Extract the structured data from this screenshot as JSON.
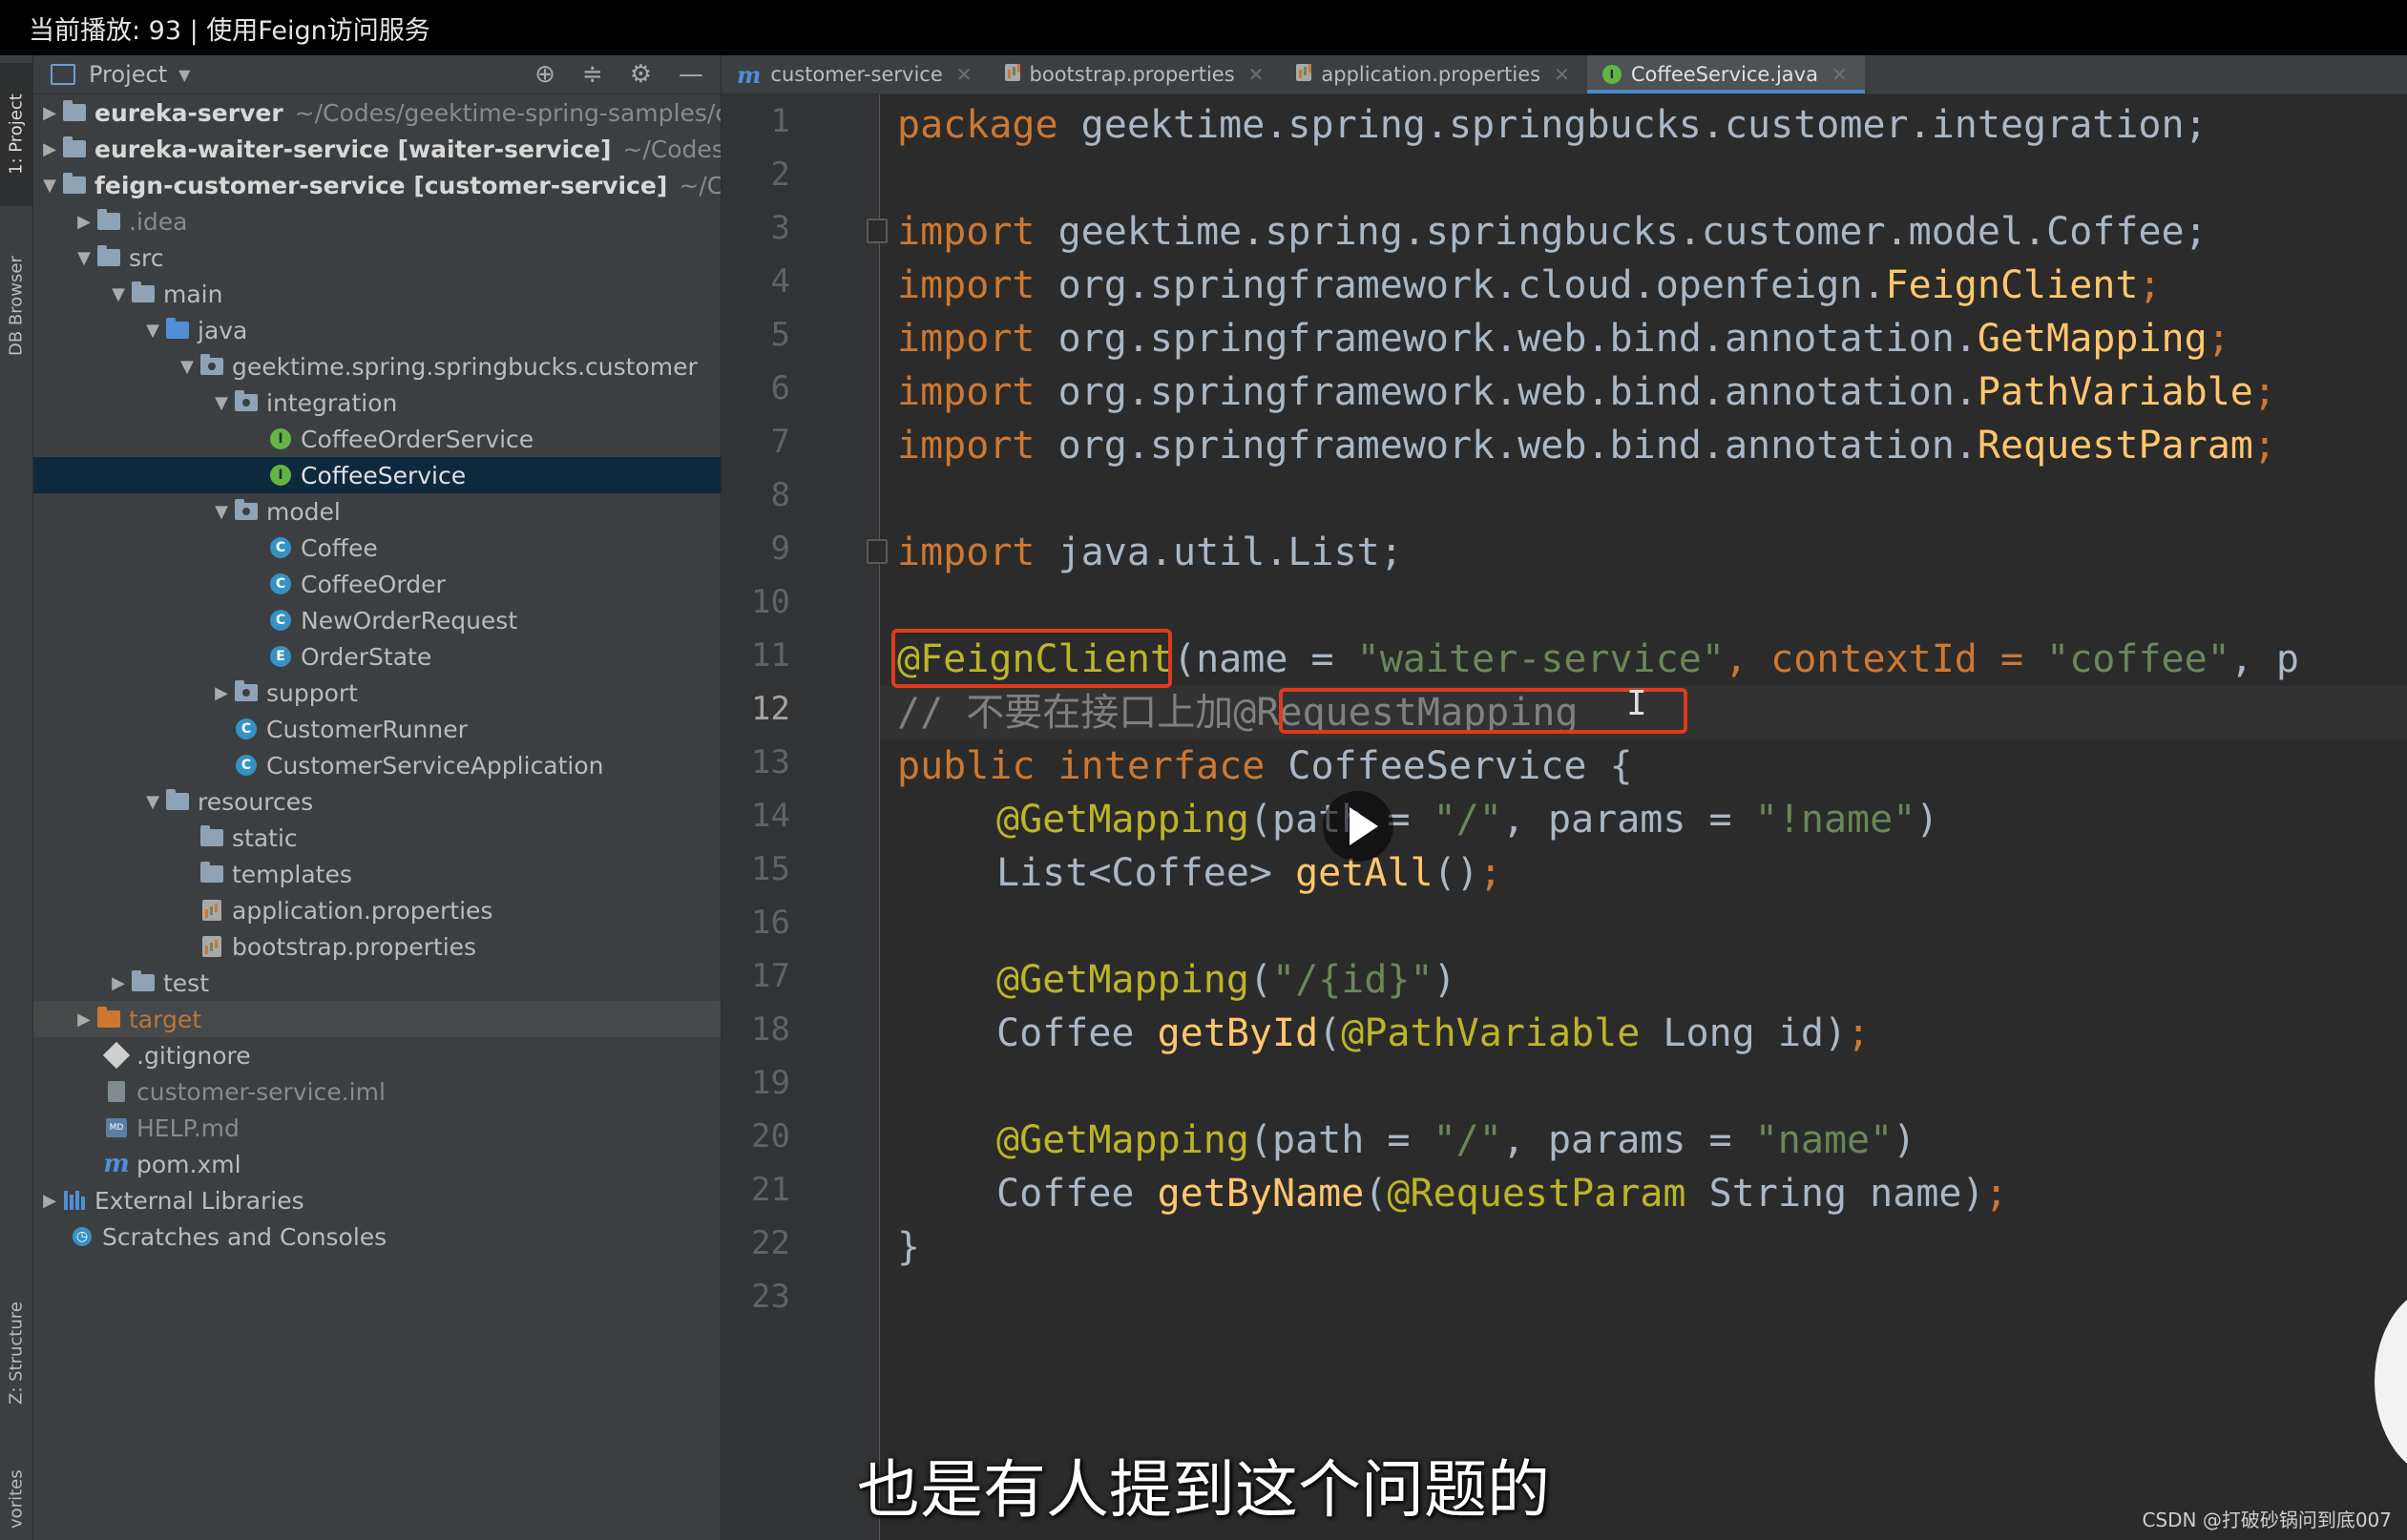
{
  "video_title": "当前播放: 93 | 使用Feign访问服务",
  "subtitle": "也是有人提到这个问题的",
  "watermark": "CSDN @打破砂锅问到底007",
  "side_tabs": {
    "project": "1: Project",
    "db": "DB Browser",
    "structure": "Z: Structure",
    "favorites": "vorites"
  },
  "project_panel": {
    "title": "Project",
    "tree": [
      {
        "name": "eureka-server",
        "extra": "~/Codes/geektime-spring-samples/c"
      },
      {
        "name": "eureka-waiter-service [waiter-service]",
        "extra": "~/Codes/ge"
      },
      {
        "name": "feign-customer-service [customer-service]",
        "extra": "~/Cod"
      },
      {
        "name": ".idea"
      },
      {
        "name": "src"
      },
      {
        "name": "main"
      },
      {
        "name": "java"
      },
      {
        "name": "geektime.spring.springbucks.customer"
      },
      {
        "name": "integration"
      },
      {
        "name": "CoffeeOrderService"
      },
      {
        "name": "CoffeeService"
      },
      {
        "name": "model"
      },
      {
        "name": "Coffee"
      },
      {
        "name": "CoffeeOrder"
      },
      {
        "name": "NewOrderRequest"
      },
      {
        "name": "OrderState"
      },
      {
        "name": "support"
      },
      {
        "name": "CustomerRunner"
      },
      {
        "name": "CustomerServiceApplication"
      },
      {
        "name": "resources"
      },
      {
        "name": "static"
      },
      {
        "name": "templates"
      },
      {
        "name": "application.properties"
      },
      {
        "name": "bootstrap.properties"
      },
      {
        "name": "test"
      },
      {
        "name": "target"
      },
      {
        "name": ".gitignore"
      },
      {
        "name": "customer-service.iml"
      },
      {
        "name": "HELP.md"
      },
      {
        "name": "pom.xml"
      },
      {
        "name": "External Libraries"
      },
      {
        "name": "Scratches and Consoles"
      }
    ]
  },
  "tabs": [
    {
      "label": "customer-service"
    },
    {
      "label": "bootstrap.properties"
    },
    {
      "label": "application.properties"
    },
    {
      "label": "CoffeeService.java"
    }
  ],
  "editor": {
    "line_numbers": [
      "1",
      "2",
      "3",
      "4",
      "5",
      "6",
      "7",
      "8",
      "9",
      "10",
      "11",
      "12",
      "13",
      "14",
      "15",
      "16",
      "17",
      "18",
      "19",
      "20",
      "21",
      "22",
      "23"
    ],
    "current_line": 12,
    "code": {
      "l1_kw": "package",
      "l1_rest": " geektime.spring.springbucks.customer.integration;",
      "import": "import",
      "l3_rest": " geektime.spring.springbucks.customer.model.Coffee;",
      "l4_pkg": " org.springframework.cloud.openfeign.",
      "l4_cls": "FeignClient",
      "l4_end": ";",
      "l5_pkg": " org.springframework.web.bind.annotation.",
      "l5_cls": "GetMapping",
      "l5_end": ";",
      "l6_pkg": " org.springframework.web.bind.annotation.",
      "l6_cls": "PathVariable",
      "l6_end": ";",
      "l7_pkg": " org.springframework.web.bind.annotation.",
      "l7_cls": "RequestParam",
      "l7_end": ";",
      "l9_rest": " java.util.List;",
      "l11_ann": "@FeignClient",
      "l11_a": "(name = ",
      "l11_s1": "\"waiter-service\"",
      "l11_b": ", contextId = ",
      "l11_s2": "\"coffee\"",
      "l11_c": ", p",
      "l12_cmt": "// 不要在接口上加@RequestMapping",
      "l13_kw": "public interface",
      "l13_rest": " CoffeeService {",
      "l14_ann": "@GetMapping",
      "l14_a": "(path = ",
      "l14_s1": "\"/\"",
      "l14_b": ", params = ",
      "l14_s2": "\"!name\"",
      "l14_c": ")",
      "l15_a": "List<Coffee> ",
      "l15_fn": "getAll",
      "l15_b": "()",
      "l15_c": ";",
      "l17_ann": "@GetMapping",
      "l17_a": "(",
      "l17_s": "\"/{id}\"",
      "l17_b": ")",
      "l18_a": "Coffee ",
      "l18_fn": "getById",
      "l18_b": "(",
      "l18_ann": "@PathVariable",
      "l18_c": " Long id)",
      "l18_d": ";",
      "l20_ann": "@GetMapping",
      "l20_a": "(path = ",
      "l20_s1": "\"/\"",
      "l20_b": ", params = ",
      "l20_s2": "\"name\"",
      "l20_c": ")",
      "l21_a": "Coffee ",
      "l21_fn": "getByName",
      "l21_b": "(",
      "l21_ann": "@RequestParam",
      "l21_c": " String name)",
      "l21_d": ";",
      "l22": "}"
    }
  },
  "colors": {
    "keyword": "#cc7832",
    "string": "#6a8759",
    "annotation": "#bbb529",
    "comment": "#808080",
    "method": "#ffc66d",
    "highlight_box": "#e03a1e",
    "selection": "#0d293e"
  }
}
